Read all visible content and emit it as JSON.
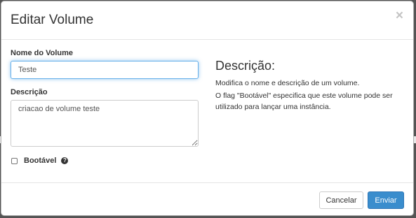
{
  "modal": {
    "title": "Editar Volume",
    "close_glyph": "×"
  },
  "form": {
    "name_label": "Nome do Volume",
    "name_value": "Teste",
    "description_label": "Descrição",
    "description_value": "criacao de volume teste",
    "bootable_label": "Bootável",
    "bootable_checked": false,
    "help_icon": "question-circle-icon"
  },
  "help": {
    "heading": "Descrição:",
    "paragraph1": "Modifica o nome e descrição de um volume.",
    "paragraph2": "O flag \"Bootável\" especifica que este volume pode ser utilizado para lançar uma instância."
  },
  "footer": {
    "cancel_label": "Cancelar",
    "submit_label": "Enviar"
  },
  "colors": {
    "primary": "#3a8dcd",
    "focus_border": "#66afe9",
    "backdrop": "#545454"
  }
}
